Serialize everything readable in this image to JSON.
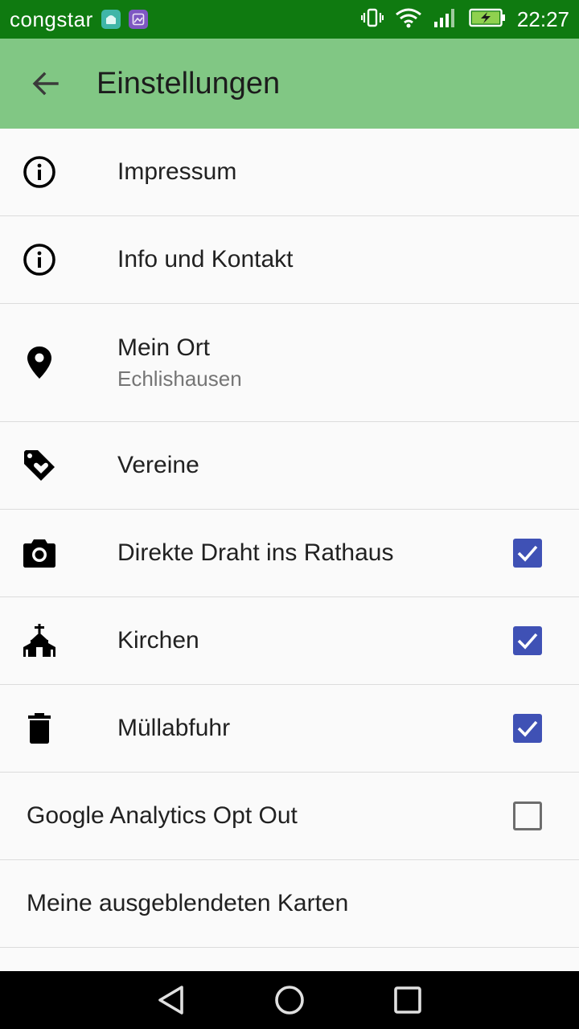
{
  "status_bar": {
    "carrier": "congstar",
    "time": "22:27",
    "icons": [
      "android-notification-icon",
      "image-notification-icon",
      "vibrate-icon",
      "wifi-icon",
      "signal-icon",
      "battery-charging-icon"
    ]
  },
  "app_bar": {
    "title": "Einstellungen",
    "back_icon": "arrow-back-icon"
  },
  "settings": {
    "impressum": {
      "title": "Impressum",
      "icon": "info-icon"
    },
    "info": {
      "title": "Info und Kontakt",
      "icon": "info-icon"
    },
    "ort": {
      "title": "Mein Ort",
      "subtitle": "Echlishausen",
      "icon": "location-pin-icon"
    },
    "vereine": {
      "title": "Vereine",
      "icon": "tag-heart-icon"
    },
    "rathaus": {
      "title": "Direkte Draht ins Rathaus",
      "icon": "camera-icon",
      "checked": true
    },
    "kirchen": {
      "title": "Kirchen",
      "icon": "church-icon",
      "checked": true
    },
    "muell": {
      "title": "Müllabfuhr",
      "icon": "trash-icon",
      "checked": true
    },
    "analytics": {
      "title": "Google Analytics Opt Out",
      "checked": false
    },
    "karten": {
      "title": "Meine ausgeblendeten Karten"
    }
  },
  "colors": {
    "status_bar": "#0f7a10",
    "app_bar": "#81c784",
    "checkbox_accent": "#3f51b5"
  },
  "nav_bar": {
    "icons": [
      "back-triangle-icon",
      "home-circle-icon",
      "recents-square-icon"
    ]
  }
}
